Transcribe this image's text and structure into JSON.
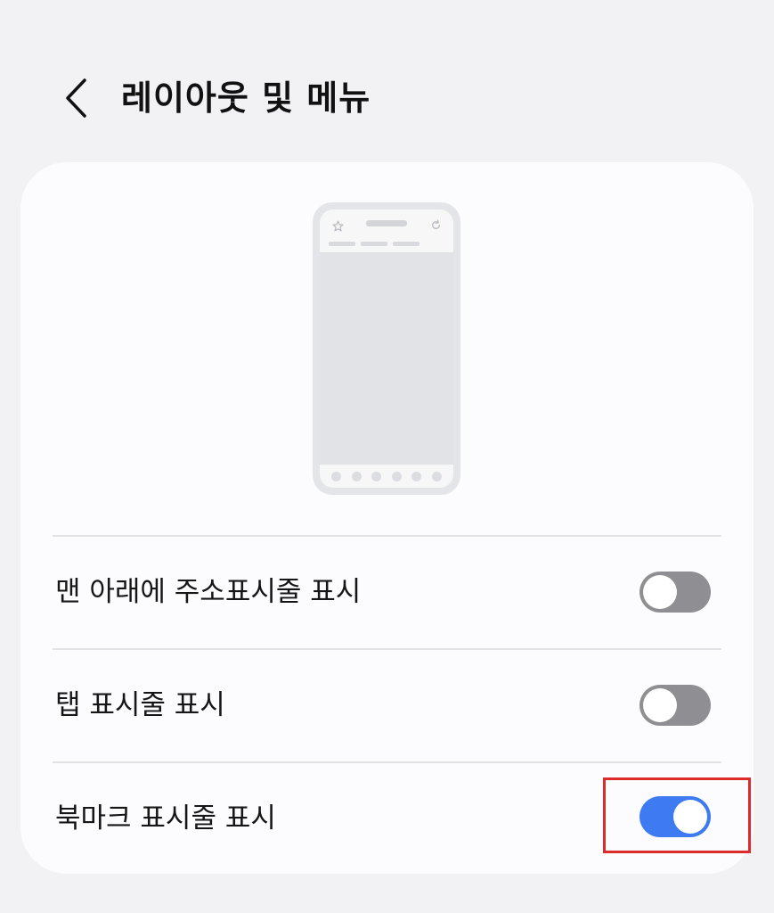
{
  "header": {
    "title": "레이아웃 및 메뉴",
    "back_icon": "chevron-left-icon"
  },
  "preview": {
    "star_icon": "star-icon",
    "reload_icon": "reload-icon"
  },
  "settings": [
    {
      "label": "맨 아래에 주소표시줄 표시",
      "enabled": false
    },
    {
      "label": "탭 표시줄 표시",
      "enabled": false
    },
    {
      "label": "북마크 표시줄 표시",
      "enabled": true
    }
  ],
  "colors": {
    "toggle_on": "#3e7bf2",
    "toggle_off": "#8e8e93",
    "highlight": "#dd2a2a"
  }
}
